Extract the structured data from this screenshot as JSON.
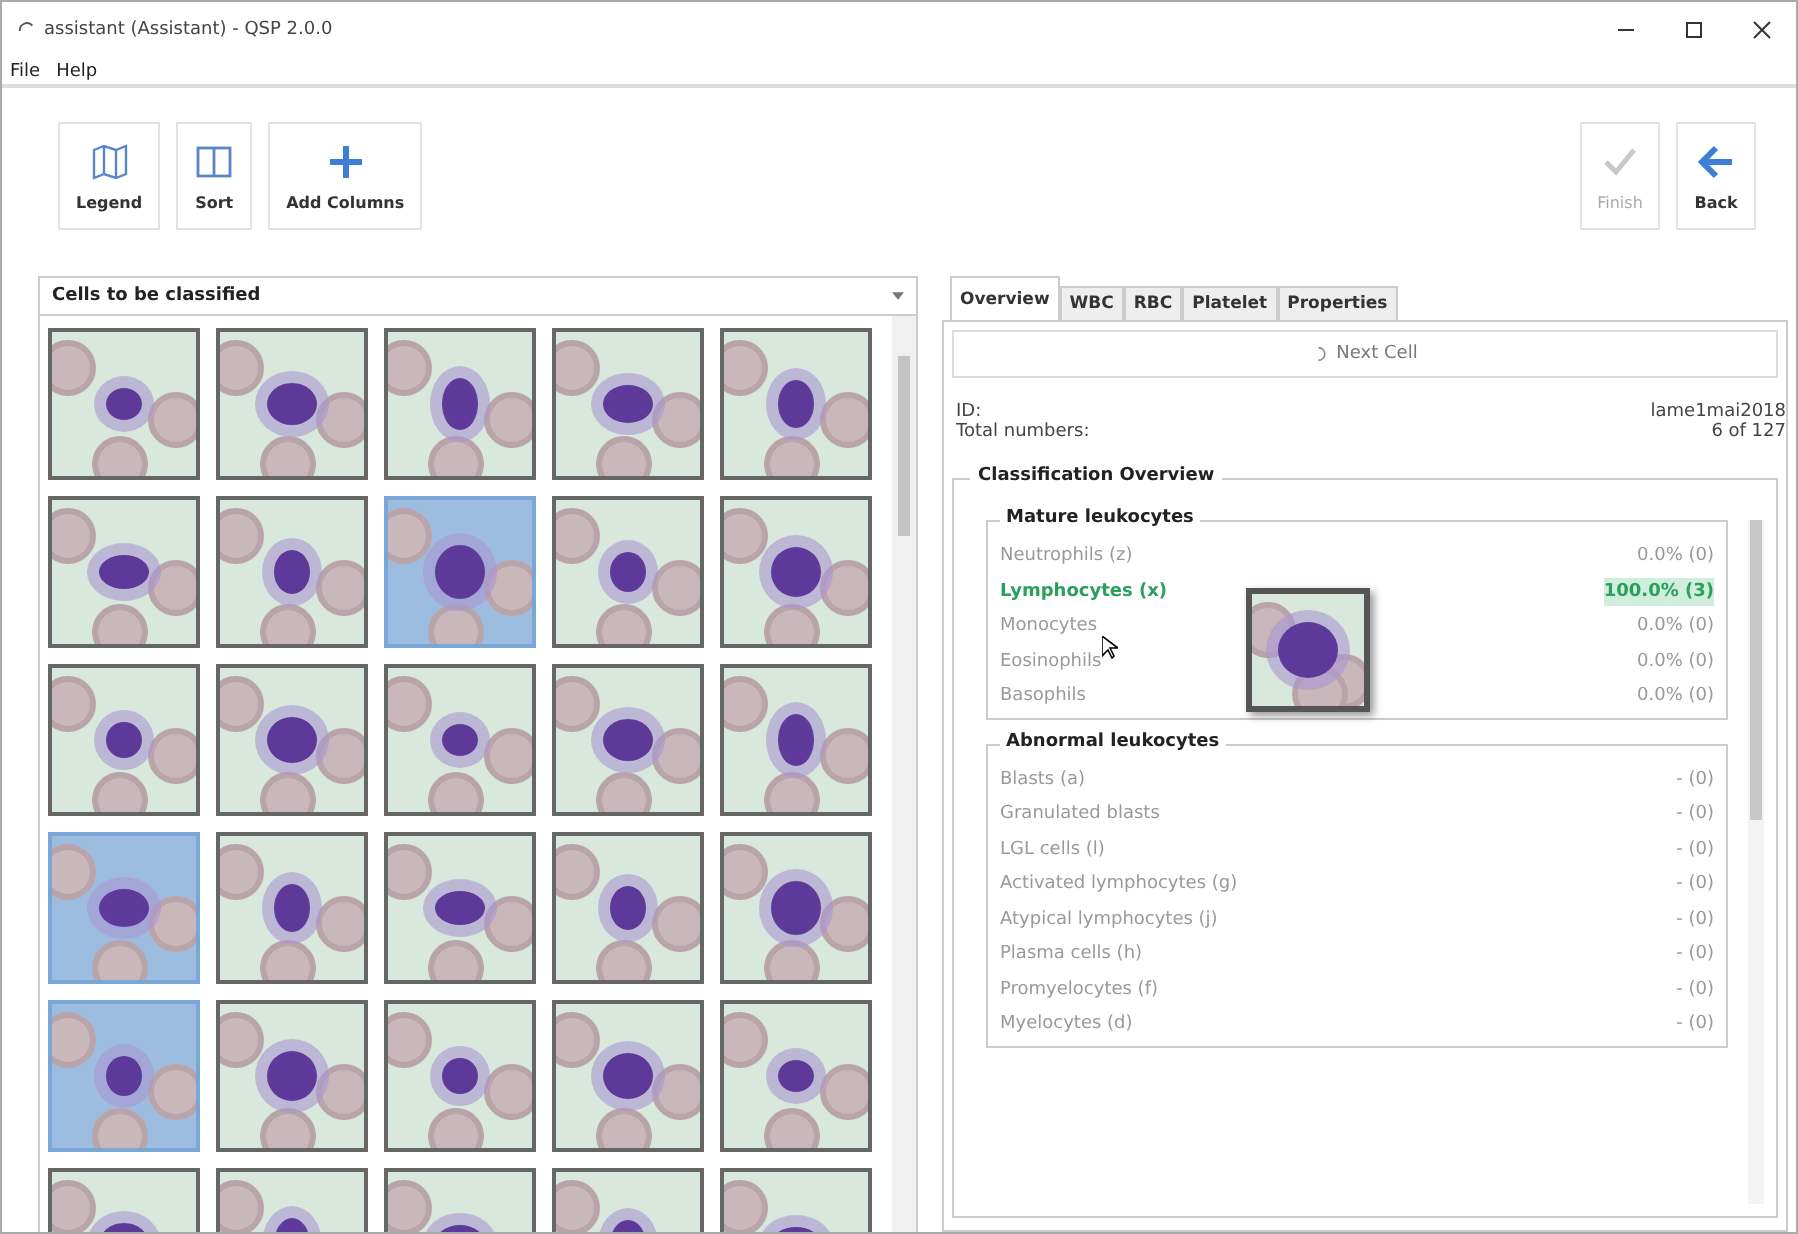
{
  "window": {
    "title": "assistant (Assistant) - QSP 2.0.0"
  },
  "menu": [
    "File",
    "Help"
  ],
  "toolbar_left": [
    {
      "label": "Legend",
      "kind": "book",
      "disabled": false
    },
    {
      "label": "Sort",
      "kind": "columns",
      "disabled": false
    },
    {
      "label": "Add Columns",
      "kind": "plus",
      "disabled": false
    }
  ],
  "toolbar_right": [
    {
      "label": "Finish",
      "kind": "check",
      "disabled": true
    },
    {
      "label": "Back",
      "kind": "arrow",
      "disabled": false
    }
  ],
  "cell_list": {
    "title": "Cells to be classified",
    "cells": [
      {
        "selected": false
      },
      {
        "selected": false
      },
      {
        "selected": false
      },
      {
        "selected": false
      },
      {
        "selected": false
      },
      {
        "selected": false
      },
      {
        "selected": false
      },
      {
        "selected": true
      },
      {
        "selected": false
      },
      {
        "selected": false
      },
      {
        "selected": false
      },
      {
        "selected": false
      },
      {
        "selected": false
      },
      {
        "selected": false
      },
      {
        "selected": false
      },
      {
        "selected": true
      },
      {
        "selected": false
      },
      {
        "selected": false
      },
      {
        "selected": false
      },
      {
        "selected": false
      },
      {
        "selected": true
      },
      {
        "selected": false
      },
      {
        "selected": false
      },
      {
        "selected": false
      },
      {
        "selected": false
      },
      {
        "selected": false
      },
      {
        "selected": false
      },
      {
        "selected": false
      },
      {
        "selected": false
      },
      {
        "selected": false
      }
    ]
  },
  "tabs": [
    {
      "label": "Overview",
      "selected": true
    },
    {
      "label": "WBC",
      "selected": false
    },
    {
      "label": "RBC",
      "selected": false
    },
    {
      "label": "Platelet",
      "selected": false
    },
    {
      "label": "Properties",
      "selected": false
    }
  ],
  "next_button": "Next Cell",
  "info": [
    {
      "label": "ID:",
      "value": "lame1mai2018"
    },
    {
      "label": "Total numbers:",
      "value": "6 of 127"
    }
  ],
  "overview": {
    "title": "Classification Overview",
    "groups": [
      {
        "title": "Mature leukocytes",
        "rows": [
          {
            "label": "Neutrophils (z)",
            "value": "0.0% (0)",
            "highlighted": false
          },
          {
            "label": "Lymphocytes (x)",
            "value": "100.0% (3)",
            "highlighted": true
          },
          {
            "label": "Monocytes",
            "value": "0.0% (0)",
            "highlighted": false
          },
          {
            "label": "Eosinophils",
            "value": "0.0% (0)",
            "highlighted": false
          },
          {
            "label": "Basophils",
            "value": "0.0% (0)",
            "highlighted": false
          }
        ]
      },
      {
        "title": "Abnormal leukocytes",
        "rows": [
          {
            "label": "Blasts (a)",
            "value": "- (0)",
            "highlighted": false
          },
          {
            "label": "Granulated blasts",
            "value": "- (0)",
            "highlighted": false
          },
          {
            "label": "LGL cells (l)",
            "value": "- (0)",
            "highlighted": false
          },
          {
            "label": "Activated lymphocytes (g)",
            "value": "- (0)",
            "highlighted": false
          },
          {
            "label": "Atypical lymphocytes (j)",
            "value": "- (0)",
            "highlighted": false
          },
          {
            "label": "Plasma cells (h)",
            "value": "- (0)",
            "highlighted": false
          },
          {
            "label": "Promyelocytes (f)",
            "value": "- (0)",
            "highlighted": false
          },
          {
            "label": "Myelocytes (d)",
            "value": "- (0)",
            "highlighted": false
          }
        ]
      }
    ]
  }
}
